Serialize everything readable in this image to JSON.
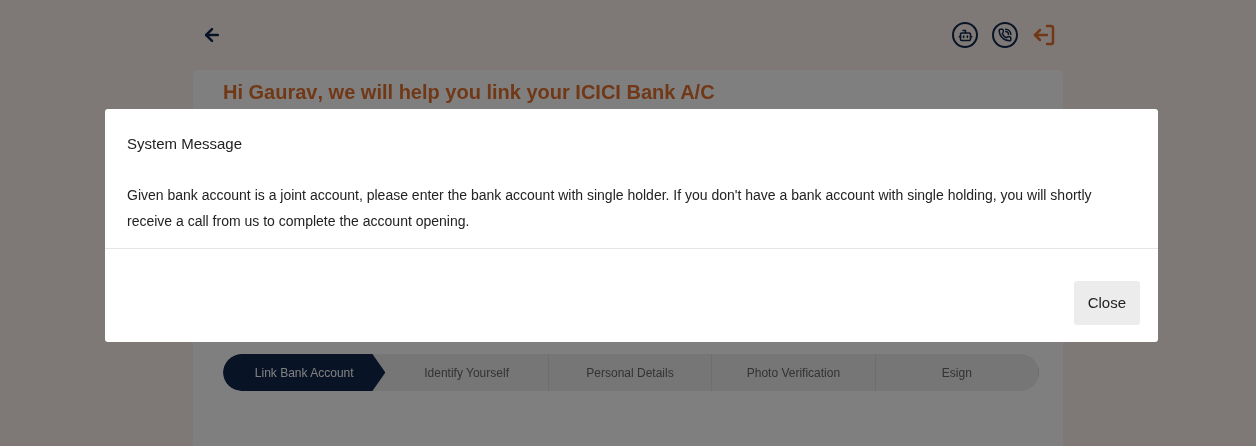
{
  "greeting": "Hi **Gaurav**, we will help you link your ICICI Bank A/C",
  "steps": [
    {
      "label": "Link Bank Account",
      "selected": true
    },
    {
      "label": "Identify Yourself",
      "selected": false
    },
    {
      "label": "Personal Details",
      "selected": false
    },
    {
      "label": "Photo Verification",
      "selected": false
    },
    {
      "label": "Esign",
      "selected": false
    }
  ],
  "dialog": {
    "title": "System Message",
    "message": "Given bank account is a joint account, please enter the bank account with single holder. If you don't have a bank account with single holding, you will shortly receive a call from us to complete the account opening.",
    "buttons": [
      "Close"
    ]
  }
}
